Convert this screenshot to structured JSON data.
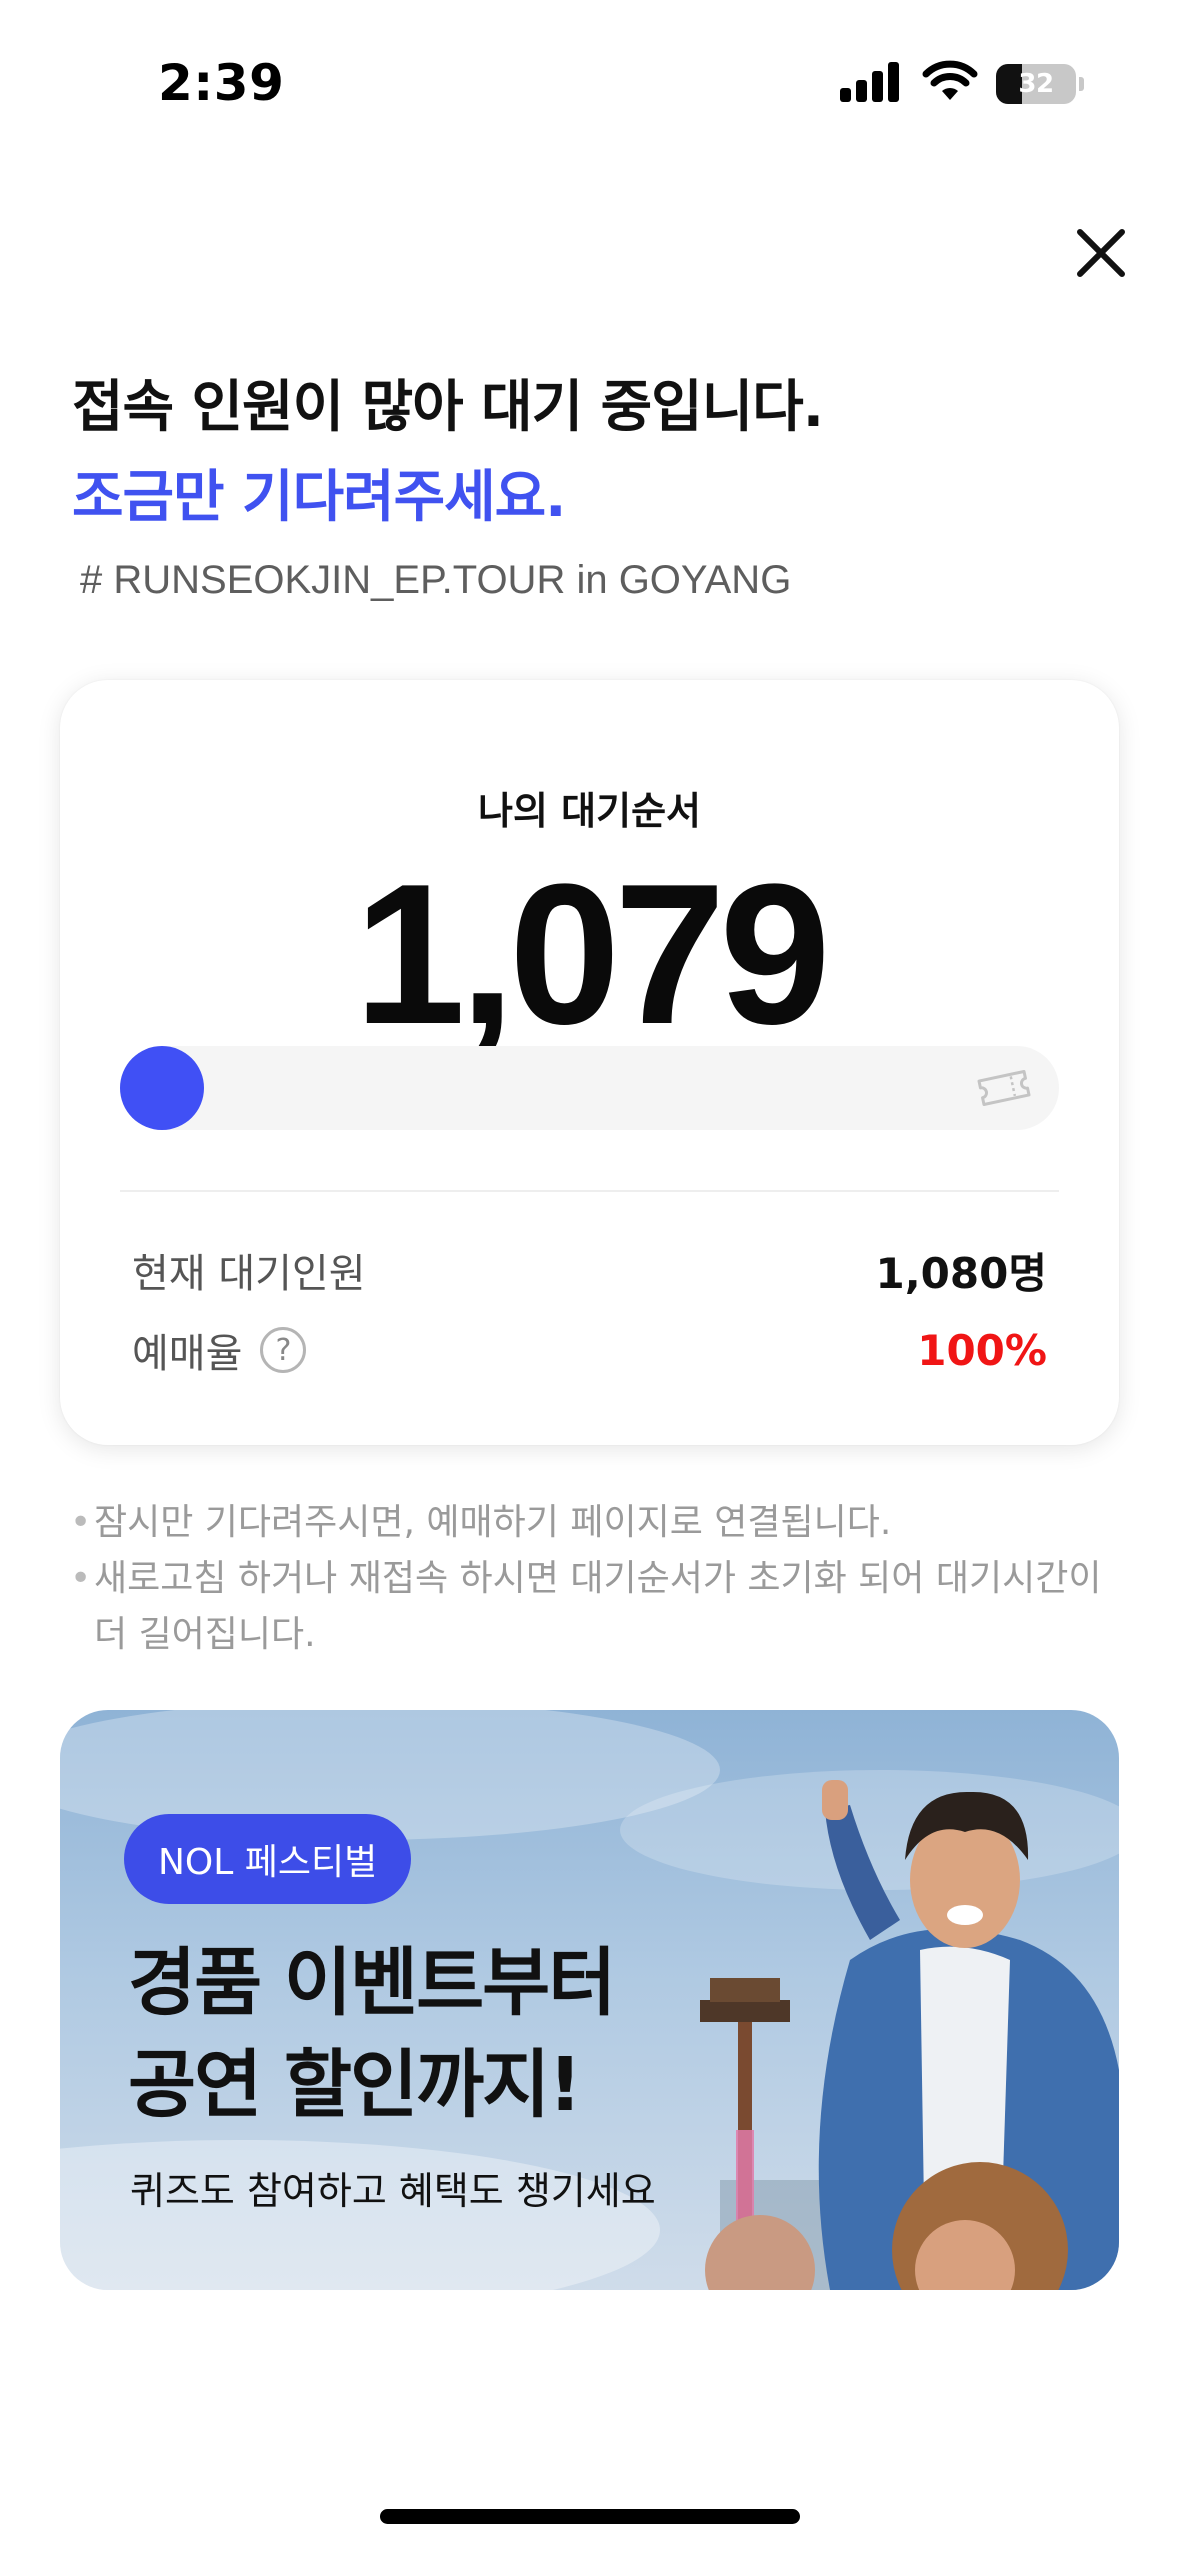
{
  "status_bar": {
    "time": "2:39",
    "battery_level": "32",
    "battery_fraction": 0.32
  },
  "header": {
    "close_icon": "close-icon"
  },
  "message": {
    "line1": "접속 인원이 많아 대기 중입니다.",
    "line2": "조금만 기다려주세요.",
    "hashtag": "# RUNSEOKJIN_EP.TOUR in GOYANG"
  },
  "queue": {
    "label": "나의 대기순서",
    "number": "1,079",
    "progress": 0.0,
    "current_waiting_label": "현재 대기인원",
    "current_waiting_value": "1,080명",
    "booking_rate_label": "예매율",
    "booking_rate_help": "?",
    "booking_rate_value": "100%"
  },
  "notices": [
    "잠시만 기다려주시면, 예매하기 페이지로 연결됩니다.",
    "새로고침 하거나 재접속 하시면 대기순서가 초기화 되어 대기시간이 더 길어집니다."
  ],
  "banner": {
    "tag": "NOL 페스티벌",
    "title_line1": "경품 이벤트부터",
    "title_line2": "공연 할인까지!",
    "subtitle": "퀴즈도 참여하고 혜택도 챙기세요"
  },
  "colors": {
    "accent": "#4052f0",
    "highlight_red": "#f01515",
    "pill": "#3d4de8"
  }
}
